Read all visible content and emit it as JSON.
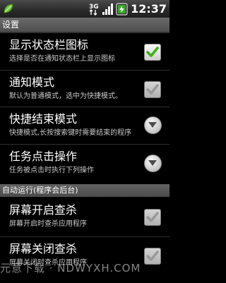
{
  "status_bar": {
    "network_type": "3G",
    "time": "12:37",
    "icons": [
      "leaf-app-icon",
      "3g-network-icon",
      "signal-strength-icon",
      "battery-charging-icon"
    ]
  },
  "title_bar": {
    "title": "设置"
  },
  "settings": [
    {
      "title": "显示状态栏图标",
      "description": "选择是否在通知状态栏上显示图标",
      "control": "checkbox",
      "checked": true,
      "enabled": true
    },
    {
      "title": "通知模式",
      "description": "默认为普通模式，选中为快捷模式。",
      "control": "checkbox",
      "checked": true,
      "enabled": false
    },
    {
      "title": "快捷结束模式",
      "description": "快捷模式,长按搜索键时需要结束的程序",
      "control": "dropdown",
      "icon": "dropdown-arrow-icon"
    },
    {
      "title": "任务点击操作",
      "description": "任务被点击时执行下列操作",
      "control": "dropdown",
      "icon": "dropdown-arrow-icon"
    }
  ],
  "section_header": {
    "label": "自动运行(程序会后台)"
  },
  "autorun_settings": [
    {
      "title": "屏幕开启查杀",
      "description": "屏幕开启时查杀应用程序",
      "control": "checkbox",
      "checked": true,
      "enabled": false
    },
    {
      "title": "屏幕关闭查杀",
      "description": "屏幕关闭时查杀应用程序",
      "control": "checkbox",
      "checked": true,
      "enabled": false
    }
  ],
  "watermark": "元意下载 · NDWYXH.COM",
  "colors": {
    "check_enabled": "#3fae1a",
    "check_disabled": "#b4b4b4",
    "background": "#000000"
  }
}
